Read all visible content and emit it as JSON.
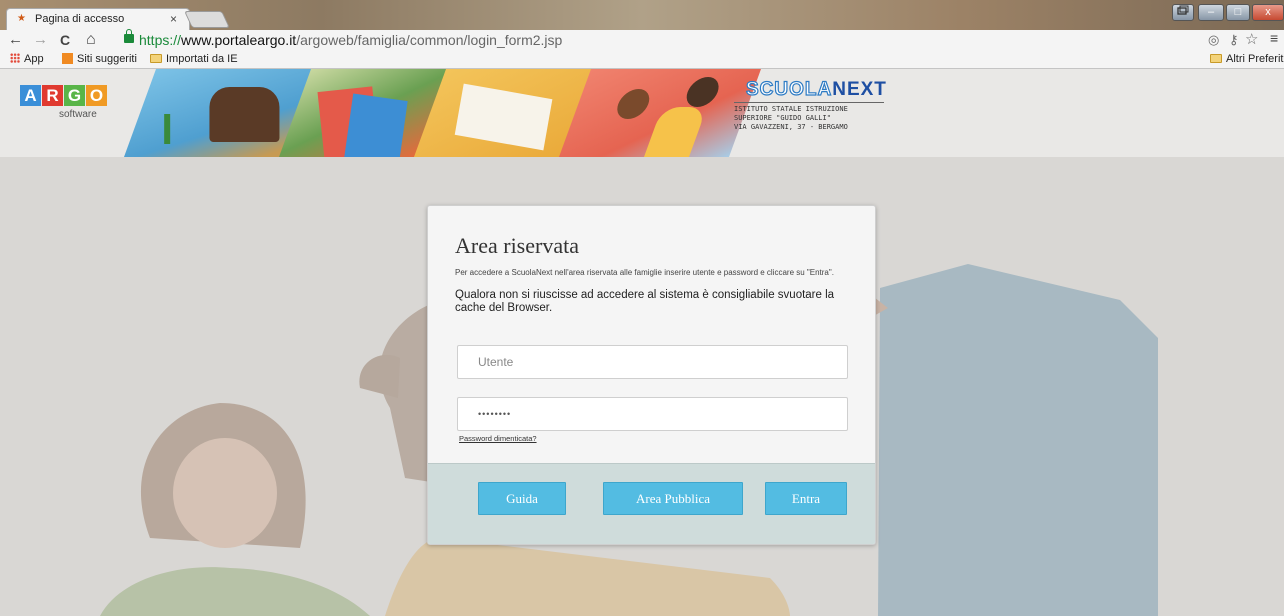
{
  "browser": {
    "tab_title": "Pagina di accesso",
    "tab_close": "×",
    "url_scheme": "https://",
    "url_host": "www.portaleargo.it",
    "url_path": "/argoweb/famiglia/common/login_form2.jsp",
    "nav": {
      "back": "←",
      "forward": "→",
      "reload": "C",
      "home": "⌂"
    },
    "window_controls": {
      "minimize": "–",
      "maximize": "□",
      "close": "x"
    },
    "bookmarks": [
      {
        "label": "App"
      },
      {
        "label": "Siti suggeriti"
      },
      {
        "label": "Importati da IE"
      }
    ],
    "other_bookmarks": "Altri Preferiti"
  },
  "header": {
    "logo_letters": [
      "A",
      "R",
      "G",
      "O"
    ],
    "logo_colors": [
      "#3b8fd8",
      "#e03a30",
      "#59b548",
      "#f09a24"
    ],
    "logo_sub": "software",
    "brand_scuola": "SCUOLA",
    "brand_next": "NEXT",
    "school_line1": "ISTITUTO STATALE ISTRUZIONE",
    "school_line2": "SUPERIORE \"GUIDO GALLI\"",
    "school_line3": "VIA GAVAZZENI, 37 - BERGAMO"
  },
  "login": {
    "title": "Area riservata",
    "intro": "Per accedere a ScuolaNext nell'area riservata alle famiglie inserire utente e password e cliccare su \"Entra\".",
    "note": "Qualora non si riuscisse ad accedere al sistema è consigliabile svuotare la cache del Browser.",
    "username_placeholder": "Utente",
    "password_mask": "••••••••",
    "forgot_password": "Password dimenticata?",
    "buttons": {
      "help": "Guida",
      "public_area": "Area Pubblica",
      "enter": "Entra"
    }
  },
  "colors": {
    "accent_button": "#53bce2",
    "url_secure": "#1a8a3a",
    "page_background": "#d9d7d4"
  }
}
